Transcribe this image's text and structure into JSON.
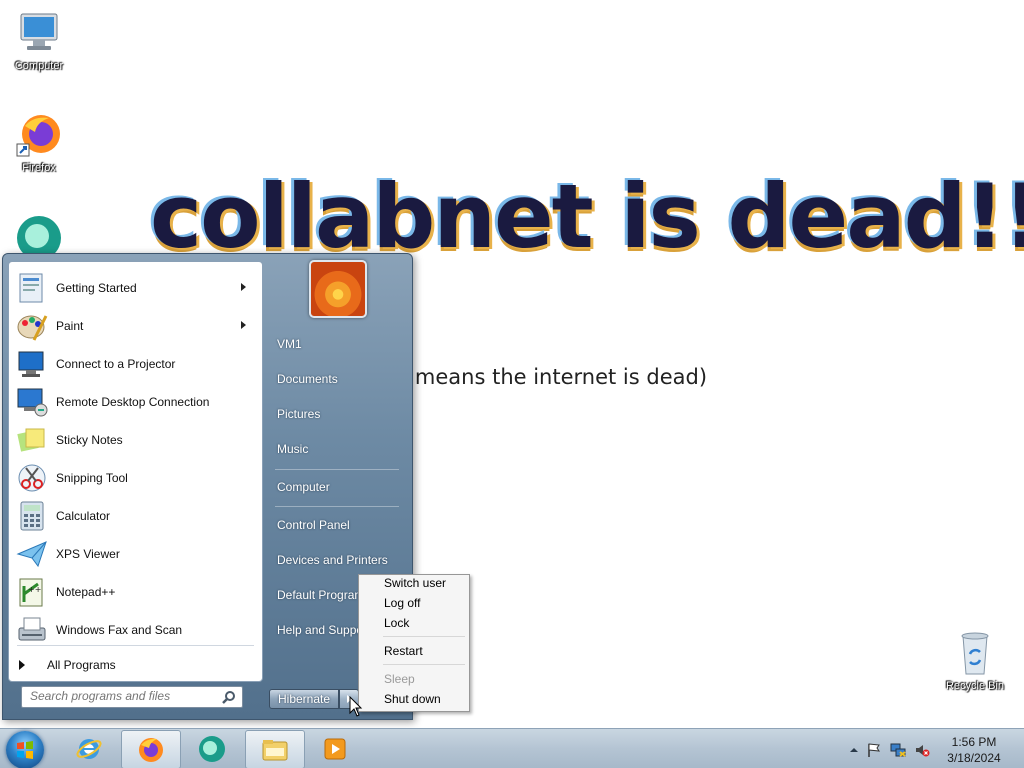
{
  "desktop": {
    "icons": [
      {
        "label": "Computer",
        "icon": "computer-icon"
      },
      {
        "label": "Firefox",
        "icon": "firefox-icon"
      },
      {
        "label": "Recycle Bin",
        "icon": "recycle-bin-icon"
      }
    ],
    "wallpaper": {
      "headline": "collabnet is dead!!!!",
      "subline": "t means the internet is dead)"
    }
  },
  "start_menu": {
    "programs": [
      {
        "label": "Getting Started",
        "icon": "getting-started-icon",
        "submenu": true
      },
      {
        "label": "Paint",
        "icon": "paint-icon",
        "submenu": true
      },
      {
        "label": "Connect to a Projector",
        "icon": "projector-icon",
        "submenu": false
      },
      {
        "label": "Remote Desktop Connection",
        "icon": "remote-desktop-icon",
        "submenu": false
      },
      {
        "label": "Sticky Notes",
        "icon": "sticky-notes-icon",
        "submenu": false
      },
      {
        "label": "Snipping Tool",
        "icon": "snipping-tool-icon",
        "submenu": false
      },
      {
        "label": "Calculator",
        "icon": "calculator-icon",
        "submenu": false
      },
      {
        "label": "XPS Viewer",
        "icon": "xps-viewer-icon",
        "submenu": false
      },
      {
        "label": "Notepad++",
        "icon": "notepadpp-icon",
        "submenu": false
      },
      {
        "label": "Windows Fax and Scan",
        "icon": "fax-scan-icon",
        "submenu": false
      }
    ],
    "all_programs_label": "All Programs",
    "search_placeholder": "Search programs and files",
    "right_links": [
      "VM1",
      "Documents",
      "Pictures",
      "Music",
      "Computer",
      "Control Panel",
      "Devices and Printers",
      "Default Programs",
      "Help and Support"
    ],
    "power_button_label": "Hibernate"
  },
  "power_menu": {
    "items": [
      {
        "label": "Switch user",
        "enabled": true
      },
      {
        "label": "Log off",
        "enabled": true
      },
      {
        "label": "Lock",
        "enabled": true
      },
      {
        "label": "Restart",
        "enabled": true
      },
      {
        "label": "Sleep",
        "enabled": false
      },
      {
        "label": "Shut down",
        "enabled": true
      }
    ]
  },
  "taskbar": {
    "pinned": [
      {
        "name": "internet-explorer-icon",
        "active": false
      },
      {
        "name": "firefox-icon",
        "active": true
      },
      {
        "name": "app-bubble-icon",
        "active": false
      },
      {
        "name": "windows-explorer-icon",
        "active": true
      },
      {
        "name": "media-player-icon",
        "active": false
      }
    ],
    "clock": {
      "time": "1:56 PM",
      "date": "3/18/2024"
    }
  },
  "colors": {
    "start_menu_accent": "#6d8aa4",
    "taskbar": "#b4c4d3"
  }
}
